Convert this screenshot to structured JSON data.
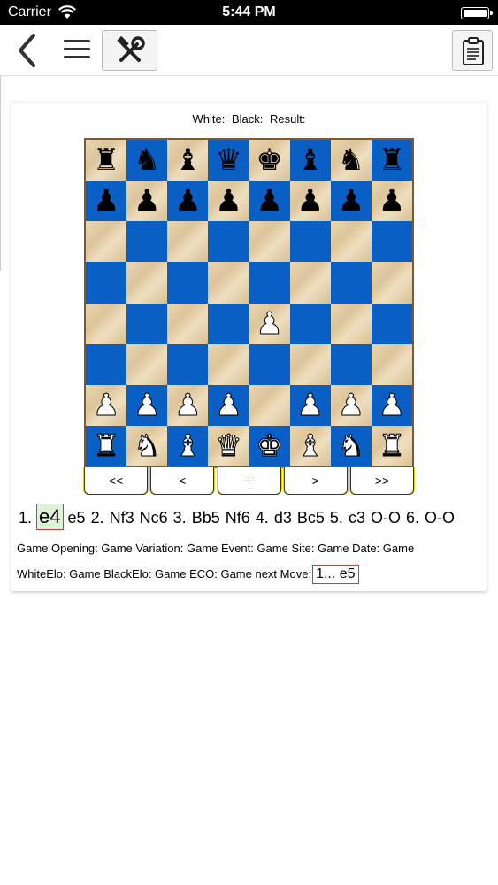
{
  "status_bar": {
    "carrier": "Carrier",
    "time": "5:44 PM"
  },
  "toolbar": {
    "back_icon": "chevron-left-icon",
    "menu_icon": "hamburger-menu-icon",
    "tools_icon": "hammer-wrench-tools-icon",
    "clipboard_icon": "clipboard-icon"
  },
  "game_header": {
    "white": "White:",
    "black": "Black:",
    "result": "Result:"
  },
  "board": {
    "light_color": "#e2cca4",
    "dark_color": "#0a5fc4",
    "ranks": [
      [
        "r",
        "n",
        "b",
        "q",
        "k",
        "b",
        "n",
        "r"
      ],
      [
        "p",
        "p",
        "p",
        "p",
        "p",
        "p",
        "p",
        "p"
      ],
      [
        "",
        "",
        "",
        "",
        "",
        "",
        "",
        ""
      ],
      [
        "",
        "",
        "",
        "",
        "",
        "",
        "",
        ""
      ],
      [
        "",
        "",
        "",
        "",
        "P",
        "",
        "",
        ""
      ],
      [
        "",
        "",
        "",
        "",
        "",
        "",
        "",
        ""
      ],
      [
        "P",
        "P",
        "P",
        "P",
        "",
        "P",
        "P",
        "P"
      ],
      [
        "R",
        "N",
        "B",
        "Q",
        "K",
        "B",
        "N",
        "R"
      ]
    ]
  },
  "nav_buttons": [
    "<<",
    "<",
    "+",
    ">",
    ">>"
  ],
  "moves": [
    {
      "text": "1.",
      "current": false
    },
    {
      "text": "e4",
      "current": true
    },
    {
      "text": "e5",
      "current": false
    },
    {
      "text": "2.",
      "current": false
    },
    {
      "text": "Nf3",
      "current": false
    },
    {
      "text": "Nc6",
      "current": false
    },
    {
      "text": "3.",
      "current": false
    },
    {
      "text": "Bb5",
      "current": false
    },
    {
      "text": "Nf6",
      "current": false
    },
    {
      "text": "4.",
      "current": false
    },
    {
      "text": "d3",
      "current": false
    },
    {
      "text": "Bc5",
      "current": false
    },
    {
      "text": "5.",
      "current": false
    },
    {
      "text": "c3",
      "current": false
    },
    {
      "text": "O-O",
      "current": false
    },
    {
      "text": "6.",
      "current": false
    },
    {
      "text": "O-O",
      "current": false
    }
  ],
  "meta": {
    "line1": "Game Opening:   Game Variation: Game Event: Game Site: Game Date: Game",
    "line2": "WhiteElo: Game BlackElo: Game ECO: Game next Move:",
    "next_move": "1... e5"
  }
}
